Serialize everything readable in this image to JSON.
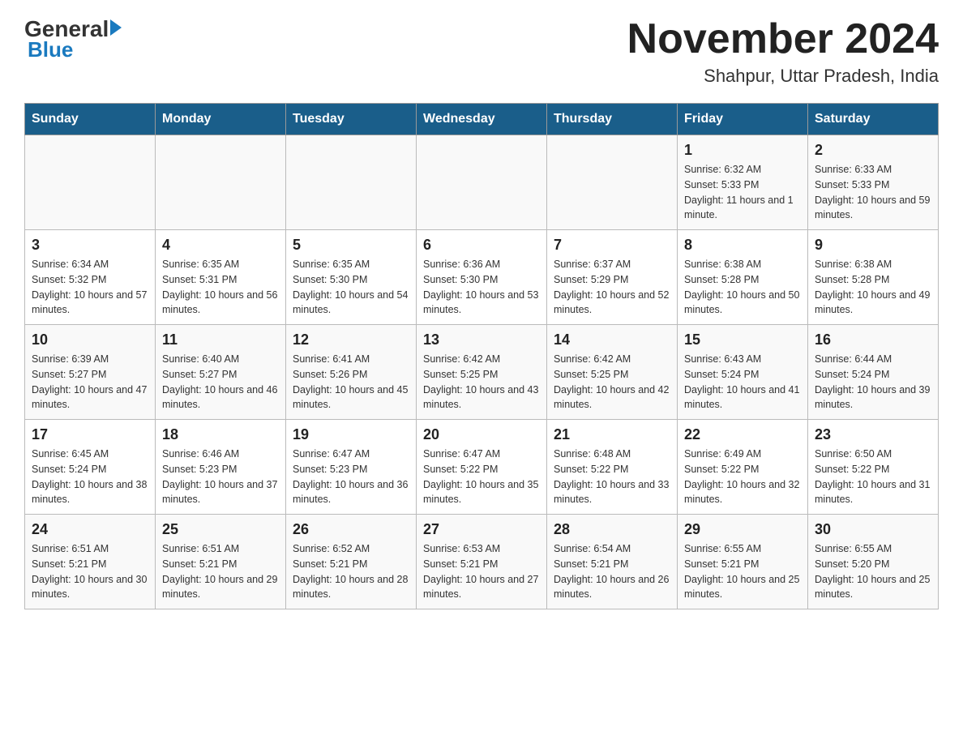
{
  "header": {
    "logo_general": "General",
    "logo_blue": "Blue",
    "month_title": "November 2024",
    "location": "Shahpur, Uttar Pradesh, India"
  },
  "weekdays": [
    "Sunday",
    "Monday",
    "Tuesday",
    "Wednesday",
    "Thursday",
    "Friday",
    "Saturday"
  ],
  "weeks": [
    [
      {
        "day": "",
        "info": ""
      },
      {
        "day": "",
        "info": ""
      },
      {
        "day": "",
        "info": ""
      },
      {
        "day": "",
        "info": ""
      },
      {
        "day": "",
        "info": ""
      },
      {
        "day": "1",
        "info": "Sunrise: 6:32 AM\nSunset: 5:33 PM\nDaylight: 11 hours and 1 minute."
      },
      {
        "day": "2",
        "info": "Sunrise: 6:33 AM\nSunset: 5:33 PM\nDaylight: 10 hours and 59 minutes."
      }
    ],
    [
      {
        "day": "3",
        "info": "Sunrise: 6:34 AM\nSunset: 5:32 PM\nDaylight: 10 hours and 57 minutes."
      },
      {
        "day": "4",
        "info": "Sunrise: 6:35 AM\nSunset: 5:31 PM\nDaylight: 10 hours and 56 minutes."
      },
      {
        "day": "5",
        "info": "Sunrise: 6:35 AM\nSunset: 5:30 PM\nDaylight: 10 hours and 54 minutes."
      },
      {
        "day": "6",
        "info": "Sunrise: 6:36 AM\nSunset: 5:30 PM\nDaylight: 10 hours and 53 minutes."
      },
      {
        "day": "7",
        "info": "Sunrise: 6:37 AM\nSunset: 5:29 PM\nDaylight: 10 hours and 52 minutes."
      },
      {
        "day": "8",
        "info": "Sunrise: 6:38 AM\nSunset: 5:28 PM\nDaylight: 10 hours and 50 minutes."
      },
      {
        "day": "9",
        "info": "Sunrise: 6:38 AM\nSunset: 5:28 PM\nDaylight: 10 hours and 49 minutes."
      }
    ],
    [
      {
        "day": "10",
        "info": "Sunrise: 6:39 AM\nSunset: 5:27 PM\nDaylight: 10 hours and 47 minutes."
      },
      {
        "day": "11",
        "info": "Sunrise: 6:40 AM\nSunset: 5:27 PM\nDaylight: 10 hours and 46 minutes."
      },
      {
        "day": "12",
        "info": "Sunrise: 6:41 AM\nSunset: 5:26 PM\nDaylight: 10 hours and 45 minutes."
      },
      {
        "day": "13",
        "info": "Sunrise: 6:42 AM\nSunset: 5:25 PM\nDaylight: 10 hours and 43 minutes."
      },
      {
        "day": "14",
        "info": "Sunrise: 6:42 AM\nSunset: 5:25 PM\nDaylight: 10 hours and 42 minutes."
      },
      {
        "day": "15",
        "info": "Sunrise: 6:43 AM\nSunset: 5:24 PM\nDaylight: 10 hours and 41 minutes."
      },
      {
        "day": "16",
        "info": "Sunrise: 6:44 AM\nSunset: 5:24 PM\nDaylight: 10 hours and 39 minutes."
      }
    ],
    [
      {
        "day": "17",
        "info": "Sunrise: 6:45 AM\nSunset: 5:24 PM\nDaylight: 10 hours and 38 minutes."
      },
      {
        "day": "18",
        "info": "Sunrise: 6:46 AM\nSunset: 5:23 PM\nDaylight: 10 hours and 37 minutes."
      },
      {
        "day": "19",
        "info": "Sunrise: 6:47 AM\nSunset: 5:23 PM\nDaylight: 10 hours and 36 minutes."
      },
      {
        "day": "20",
        "info": "Sunrise: 6:47 AM\nSunset: 5:22 PM\nDaylight: 10 hours and 35 minutes."
      },
      {
        "day": "21",
        "info": "Sunrise: 6:48 AM\nSunset: 5:22 PM\nDaylight: 10 hours and 33 minutes."
      },
      {
        "day": "22",
        "info": "Sunrise: 6:49 AM\nSunset: 5:22 PM\nDaylight: 10 hours and 32 minutes."
      },
      {
        "day": "23",
        "info": "Sunrise: 6:50 AM\nSunset: 5:22 PM\nDaylight: 10 hours and 31 minutes."
      }
    ],
    [
      {
        "day": "24",
        "info": "Sunrise: 6:51 AM\nSunset: 5:21 PM\nDaylight: 10 hours and 30 minutes."
      },
      {
        "day": "25",
        "info": "Sunrise: 6:51 AM\nSunset: 5:21 PM\nDaylight: 10 hours and 29 minutes."
      },
      {
        "day": "26",
        "info": "Sunrise: 6:52 AM\nSunset: 5:21 PM\nDaylight: 10 hours and 28 minutes."
      },
      {
        "day": "27",
        "info": "Sunrise: 6:53 AM\nSunset: 5:21 PM\nDaylight: 10 hours and 27 minutes."
      },
      {
        "day": "28",
        "info": "Sunrise: 6:54 AM\nSunset: 5:21 PM\nDaylight: 10 hours and 26 minutes."
      },
      {
        "day": "29",
        "info": "Sunrise: 6:55 AM\nSunset: 5:21 PM\nDaylight: 10 hours and 25 minutes."
      },
      {
        "day": "30",
        "info": "Sunrise: 6:55 AM\nSunset: 5:20 PM\nDaylight: 10 hours and 25 minutes."
      }
    ]
  ]
}
